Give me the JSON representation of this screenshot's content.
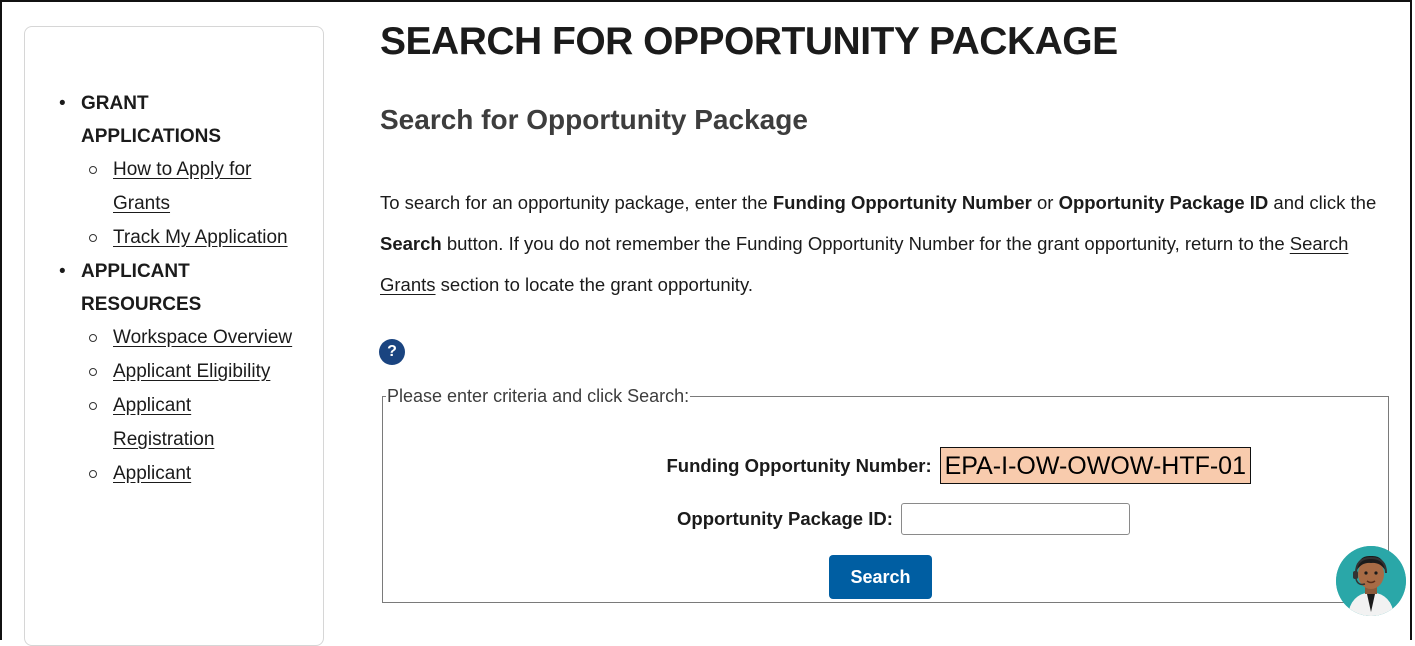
{
  "sidebar": {
    "sections": [
      {
        "heading": "GRANT APPLICATIONS",
        "items": [
          "How to Apply for Grants",
          "Track My Application"
        ]
      },
      {
        "heading": "APPLICANT RESOURCES",
        "items": [
          "Workspace Overview",
          "Applicant Eligibility",
          "Applicant Registration",
          "Applicant"
        ]
      }
    ]
  },
  "main": {
    "page_title": "SEARCH FOR OPPORTUNITY PACKAGE",
    "section_title": "Search for Opportunity Package",
    "intro": {
      "p1": "To search for an opportunity package, enter the ",
      "b1": "Funding Opportunity Number",
      "p2": " or ",
      "b2": "Opportunity Package ID",
      "p3": " and click the ",
      "b3": "Search",
      "p4": " button. If you do not remember the Funding Opportunity Number for the grant opportunity, return to the ",
      "link": "Search Grants",
      "p5": " section to locate the grant opportunity."
    },
    "help_icon": "question-circle-icon",
    "help_symbol": "?",
    "form": {
      "legend": "Please enter criteria and click Search:",
      "fon_label": "Funding Opportunity Number:",
      "fon_value": "EPA-I-OW-OWOW-HTF-01",
      "pid_label": "Opportunity Package ID:",
      "pid_value": "",
      "search_label": "Search"
    }
  },
  "chat_widget": {
    "icon": "support-agent-avatar-icon"
  },
  "colors": {
    "primary_button": "#005ea2",
    "help_icon_bg": "#1a4480",
    "highlight": "#f8cbad",
    "chat_bg": "#2aa7a8"
  }
}
